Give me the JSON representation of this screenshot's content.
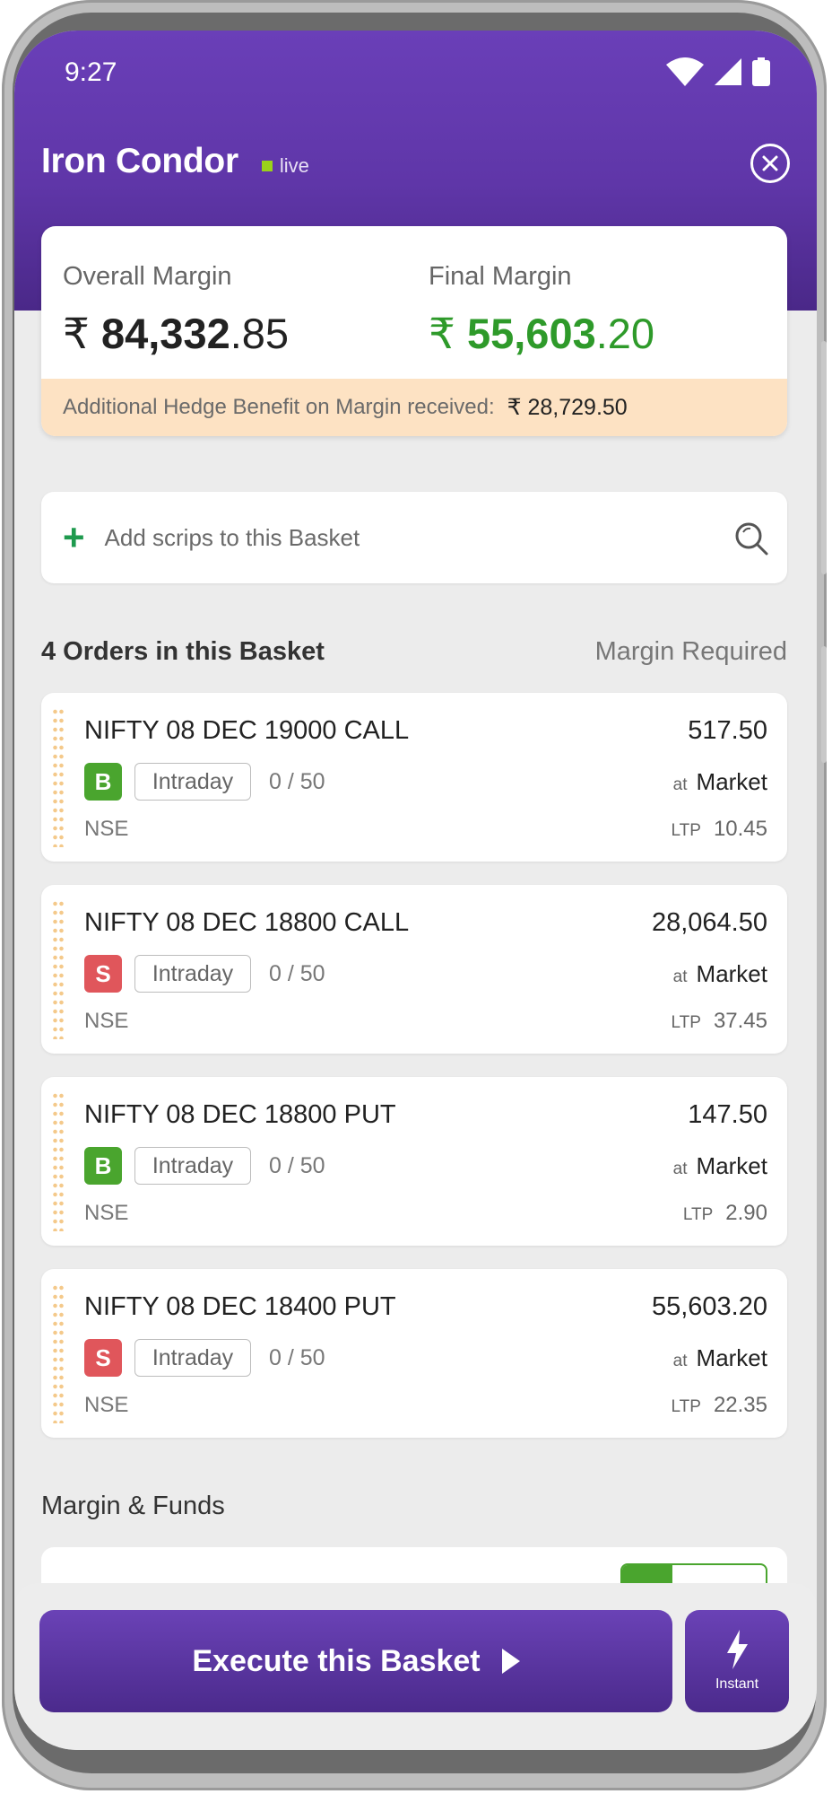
{
  "status": {
    "time": "9:27"
  },
  "header": {
    "title": "Iron Condor",
    "live_label": "live"
  },
  "margin": {
    "overall_label": "Overall Margin",
    "overall_currency": "₹",
    "overall_int": "84,332",
    "overall_dec": ".85",
    "final_label": "Final Margin",
    "final_currency": "₹",
    "final_int": "55,603",
    "final_dec": ".20",
    "hedge_label": "Additional Hedge Benefit on Margin received:",
    "hedge_amount": "₹ 28,729.50",
    "final_color": "#2e9a2a"
  },
  "search": {
    "placeholder": "Add scrips to this Basket"
  },
  "orders_header": {
    "title": "4 Orders in this Basket",
    "right_label": "Margin Required"
  },
  "orders": [
    {
      "name": "NIFTY 08 DEC 19000 CALL",
      "side": "B",
      "product": "Intraday",
      "qty": "0 / 50",
      "exchange": "NSE",
      "margin": "517.50",
      "at_label": "at",
      "order_type": "Market",
      "ltp_label": "LTP",
      "ltp": "10.45"
    },
    {
      "name": "NIFTY 08 DEC 18800 CALL",
      "side": "S",
      "product": "Intraday",
      "qty": "0 / 50",
      "exchange": "NSE",
      "margin": "28,064.50",
      "at_label": "at",
      "order_type": "Market",
      "ltp_label": "LTP",
      "ltp": "37.45"
    },
    {
      "name": "NIFTY 08 DEC 18800 PUT",
      "side": "B",
      "product": "Intraday",
      "qty": "0 / 50",
      "exchange": "NSE",
      "margin": "147.50",
      "at_label": "at",
      "order_type": "Market",
      "ltp_label": "LTP",
      "ltp": "2.90"
    },
    {
      "name": "NIFTY 08 DEC 18400 PUT",
      "side": "S",
      "product": "Intraday",
      "qty": "0 / 50",
      "exchange": "NSE",
      "margin": "55,603.20",
      "at_label": "at",
      "order_type": "Market",
      "ltp_label": "LTP",
      "ltp": "22.35"
    }
  ],
  "funds": {
    "title": "Margin & Funds"
  },
  "actions": {
    "execute_label": "Execute this Basket",
    "instant_label": "Instant"
  },
  "colors": {
    "accent": "#5f36a8",
    "buy": "#4aa52e",
    "sell": "#e0565b",
    "hedge_bg": "#fde2c3"
  },
  "icons": [
    "wifi-icon",
    "signal-icon",
    "battery-icon",
    "close-icon",
    "plus-icon",
    "search-icon",
    "play-icon",
    "lightning-icon"
  ]
}
